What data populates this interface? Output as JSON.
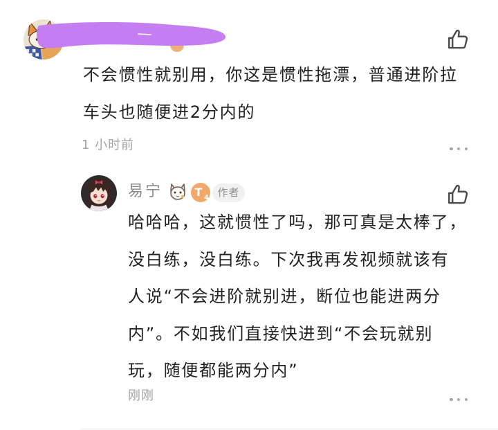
{
  "comment": {
    "avatar_icon": "fox-cartoon-avatar",
    "text_lines": [
      "不会惯性就别用，你这是惯性拖漂，普通进阶拉",
      "车头也随便进2分内的"
    ],
    "time": "1 小时前"
  },
  "reply": {
    "avatar_icon": "anime-girl-avatar",
    "username": "易宁",
    "fan_badge_icon": "cartoon-fan-badge-icon",
    "level_badge": {
      "letter": "T",
      "number": "4"
    },
    "author_tag": "作者",
    "text_lines": [
      "哈哈哈，这就惯性了吗，那可真是太棒了，",
      "没白练，没白练。下次我再发视频就该有",
      "人说“不会进阶就别进，断位也能进两分",
      "内”。不如我们直接快进到“不会玩就别",
      "玩，随便都能两分内”"
    ],
    "time": "刚刚"
  },
  "icons": {
    "like": "thumbs-up-icon",
    "more": "more-dots-icon",
    "redaction": "purple-scribble"
  },
  "colors": {
    "text": "#222222",
    "meta": "#a2a2a2",
    "username": "#8a8a8a",
    "icon": "#4a4a4a",
    "badge": "#f2a868",
    "tag-bg": "#f1f1f1",
    "tag-text": "#8f8f8f",
    "divider": "#ececec",
    "redaction": "#c57ef2"
  }
}
